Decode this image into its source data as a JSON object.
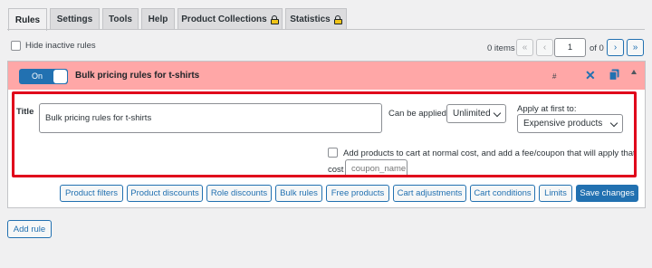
{
  "tabs": [
    {
      "label": "Rules",
      "active": true
    },
    {
      "label": "Settings"
    },
    {
      "label": "Tools"
    },
    {
      "label": "Help"
    },
    {
      "label": "Product Collections",
      "icon": "lock-icon"
    },
    {
      "label": "Statistics",
      "icon": "lock-icon"
    }
  ],
  "filters": {
    "hide_inactive_label": "Hide inactive rules",
    "hide_inactive_checked": false
  },
  "pagination": {
    "items_text": "0 items",
    "first": "«",
    "prev": "‹",
    "current_page": "1",
    "of_text": "of 0",
    "next": "›",
    "last": "»"
  },
  "rule": {
    "toggle_label": "On",
    "enabled": true,
    "title_display": "Bulk pricing rules for t-shirts",
    "hash": "#",
    "title_label": "Title",
    "title_value": "Bulk pricing rules for t-shirts",
    "can_be_applied_label": "Can be applied:",
    "can_be_applied_value": "Unlimited",
    "apply_first_label": "Apply at first to:",
    "apply_first_value": "Expensive products",
    "add_products_text": "Add products to cart at normal cost, and add a fee/coupon that will apply that",
    "cost_label": "cost",
    "coupon_placeholder": "coupon_name",
    "add_products_checked": false,
    "section_tabs": [
      "Product filters",
      "Product discounts",
      "Role discounts",
      "Bulk rules",
      "Free products",
      "Cart adjustments",
      "Cart conditions",
      "Limits"
    ],
    "save_label": "Save changes"
  },
  "add_rule_label": "Add rule",
  "colors": {
    "accent": "#2271b1",
    "header_bg": "#ffa7a7",
    "highlight": "#e0001b"
  }
}
